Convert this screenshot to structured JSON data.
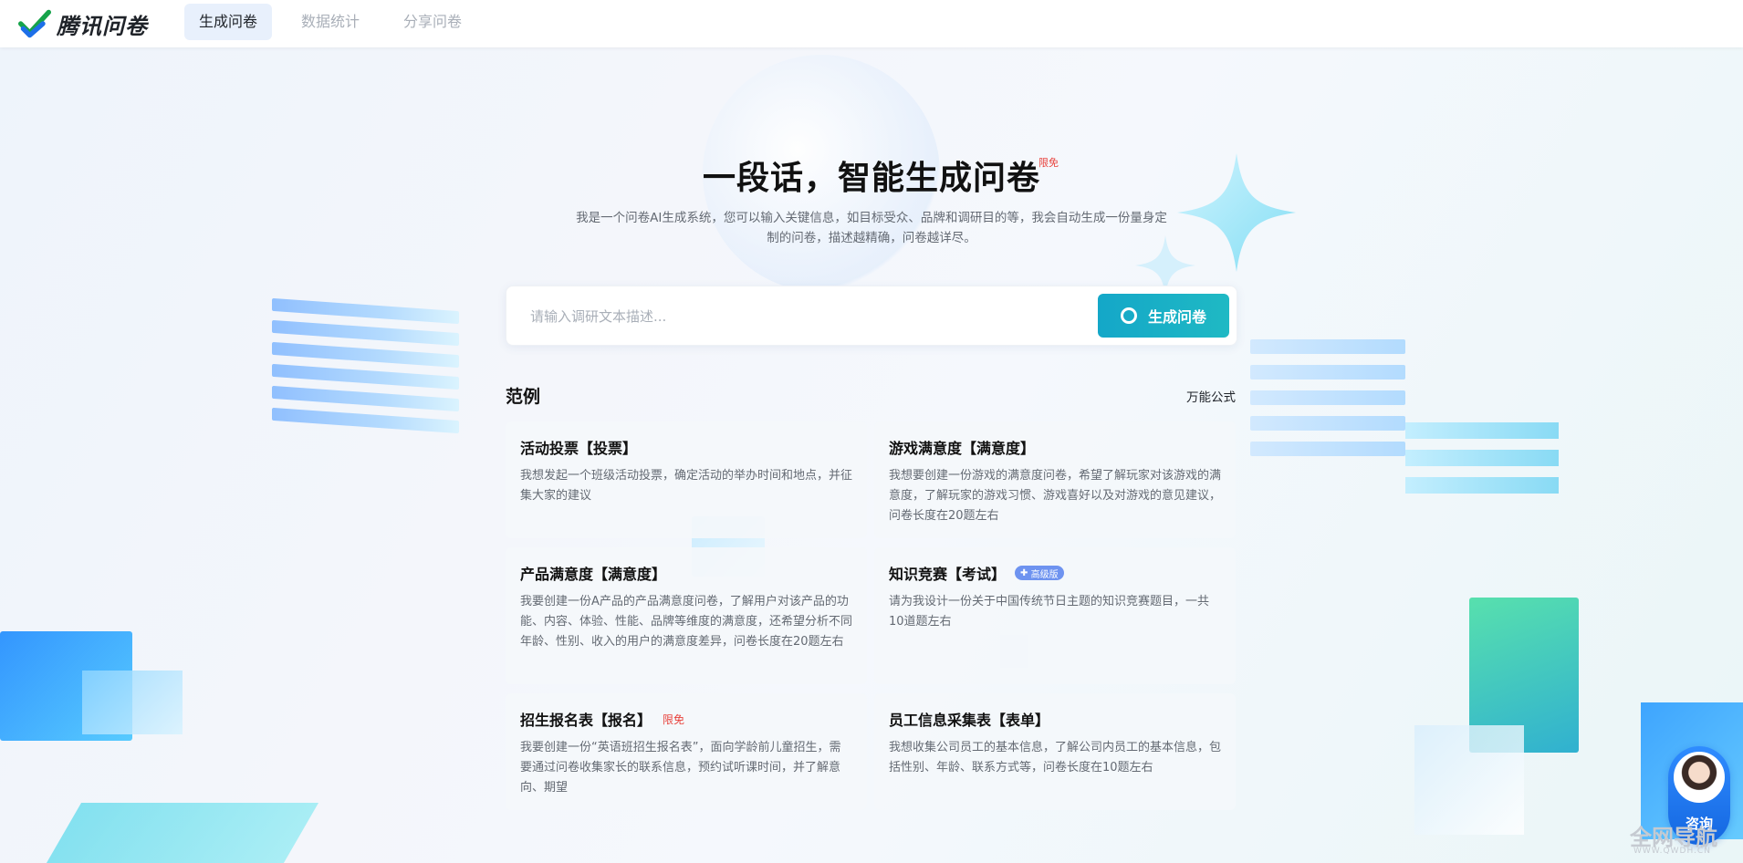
{
  "header": {
    "logo_text": "腾讯问卷",
    "nav": [
      {
        "label": "生成问卷",
        "active": true
      },
      {
        "label": "数据统计",
        "active": false
      },
      {
        "label": "分享问卷",
        "active": false
      }
    ]
  },
  "hero": {
    "title": "一段话，智能生成问卷",
    "badge": "限免",
    "description": "我是一个问卷AI生成系统，您可以输入关键信息，如目标受众、品牌和调研目的等，我会自动生成一份量身定制的问卷，描述越精确，问卷越详尽。"
  },
  "search": {
    "placeholder": "请输入调研文本描述...",
    "value": "",
    "button_label": "生成问卷"
  },
  "examples": {
    "heading": "范例",
    "link": "万能公式",
    "cards": [
      {
        "title": "活动投票【投票】",
        "desc": "我想发起一个班级活动投票，确定活动的举办时间和地点，并征集大家的建议"
      },
      {
        "title": "游戏满意度【满意度】",
        "desc": "我想要创建一份游戏的满意度问卷，希望了解玩家对该游戏的满意度，了解玩家的游戏习惯、游戏喜好以及对游戏的意见建议，问卷长度在20题左右"
      },
      {
        "title": "产品满意度【满意度】",
        "desc": "我要创建一份A产品的产品满意度问卷，了解用户对该产品的功能、内容、体验、性能、品牌等维度的满意度，还希望分析不同年龄、性别、收入的用户的满意度差异，问卷长度在20题左右"
      },
      {
        "title": "知识竞赛【考试】",
        "tag": "高级版",
        "desc": "请为我设计一份关于中国传统节日主题的知识竞赛题目，一共10道题左右"
      },
      {
        "title": "招生报名表【报名】",
        "tag": "限免",
        "desc": "我要创建一份“英语班招生报名表”，面向学龄前儿童招生，需要通过问卷收集家长的联系信息，预约试听课时间，并了解意向、期望"
      },
      {
        "title": "员工信息采集表【表单】",
        "desc": "我想收集公司员工的基本信息，了解公司内员工的基本信息，包括性别、年龄、联系方式等，问卷长度在10题左右"
      }
    ]
  },
  "consult": {
    "label": "咨询"
  },
  "watermark": {
    "text": "全网导航",
    "sub": "WWW.QWDH.CN"
  },
  "colors": {
    "accent": "#14a7c8",
    "nav_active_bg": "#e8f0fc",
    "free_red": "#e8423c",
    "adv_blue": "#6e93f0"
  }
}
